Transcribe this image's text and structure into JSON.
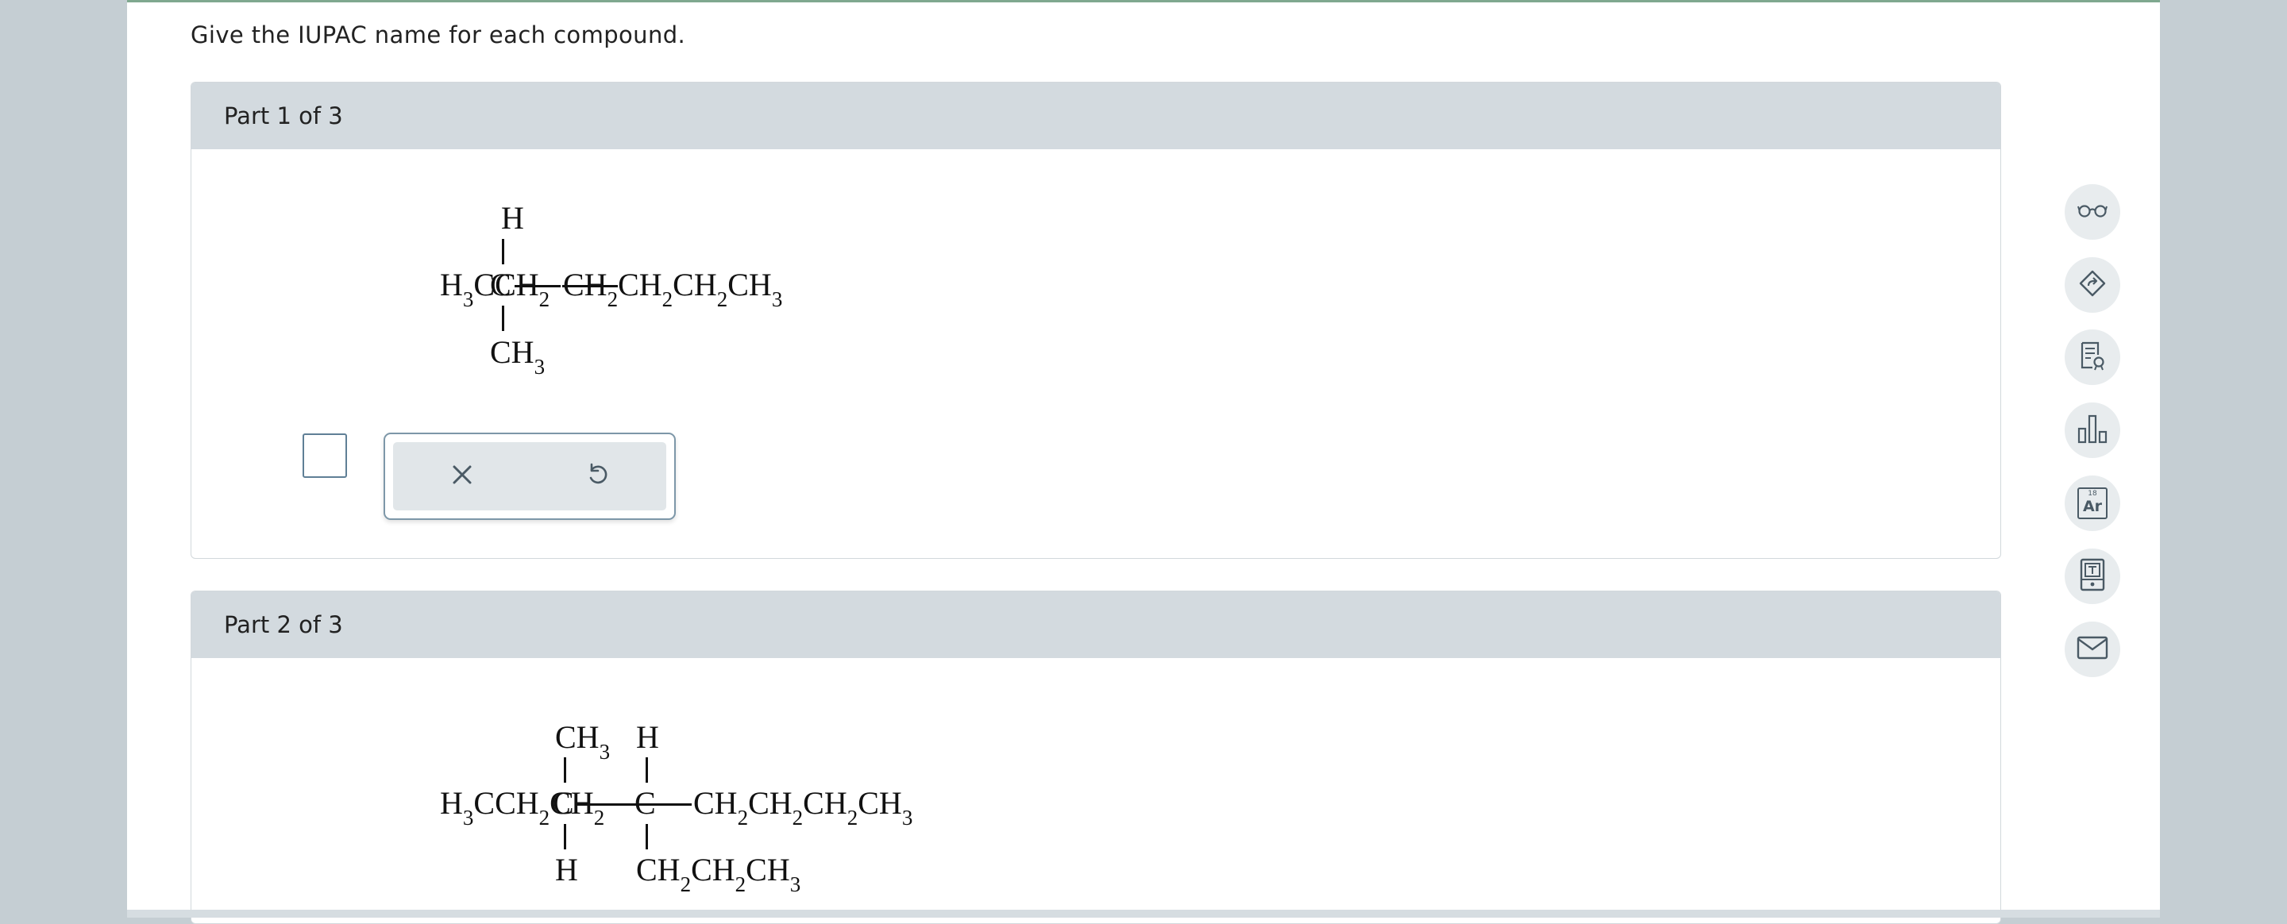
{
  "question": {
    "prompt": "Give the IUPAC name for each compound."
  },
  "parts": [
    {
      "title": "Part 1 of 3",
      "molecule": {
        "left_chain": "H3CCH2",
        "center_atom": "C",
        "top_substituent": "H",
        "bottom_substituent": "CH3",
        "right_chain": "CH2CH2CH2CH3"
      },
      "answer_value": ""
    },
    {
      "title": "Part 2 of 3",
      "molecule": {
        "left_chain": "H3CCH2CH2",
        "atom1": "C",
        "atom1_top": "CH3",
        "atom1_bottom": "H",
        "atom2": "C",
        "atom2_top": "H",
        "atom2_bottom": "CH2CH2CH3",
        "right_chain": "CH2CH2CH2CH3"
      }
    }
  ],
  "tools": {
    "clear_icon": "close-icon",
    "undo_icon": "undo-icon"
  },
  "sidebar": {
    "icons": [
      "glasses-icon",
      "share-icon",
      "notes-icon",
      "bar-chart-icon",
      "periodic-table-icon",
      "calculator-icon",
      "mail-icon"
    ],
    "periodic": {
      "number": "18",
      "symbol": "Ar"
    }
  },
  "colors": {
    "page_bg": "#c5ced3",
    "header_bg": "#d3dadf",
    "accent_top": "#7fa88f",
    "icon": "#4a5a65"
  }
}
